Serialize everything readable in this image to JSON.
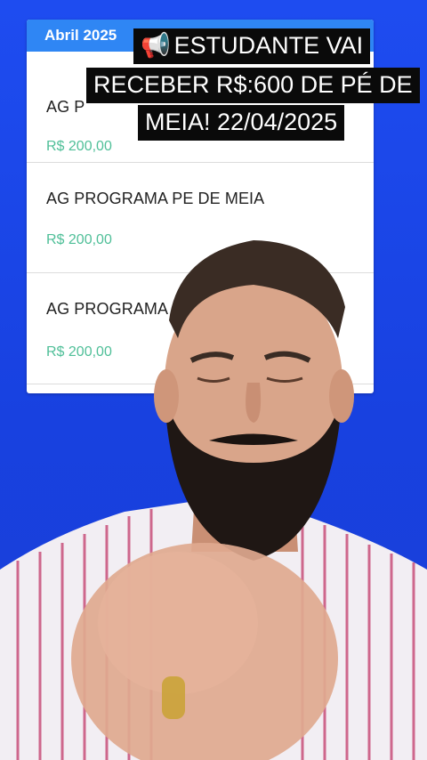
{
  "card": {
    "header": "Abril 2025",
    "transactions": [
      {
        "title": "AG P",
        "value": "R$ 200,00"
      },
      {
        "title": "AG PROGRAMA PE DE MEIA",
        "value": "R$ 200,00"
      },
      {
        "title": "AG PROGRAMA P",
        "value": "R$ 200,00"
      }
    ]
  },
  "caption": {
    "icon": "📢",
    "line1": "ESTUDANTE VAI",
    "line2": "RECEBER R$:600 DE PÉ DE",
    "line3": "MEIA! 22/04/2025"
  },
  "colors": {
    "background": "#1a45e6",
    "header": "#2f86f4",
    "value": "#4fbf98"
  }
}
